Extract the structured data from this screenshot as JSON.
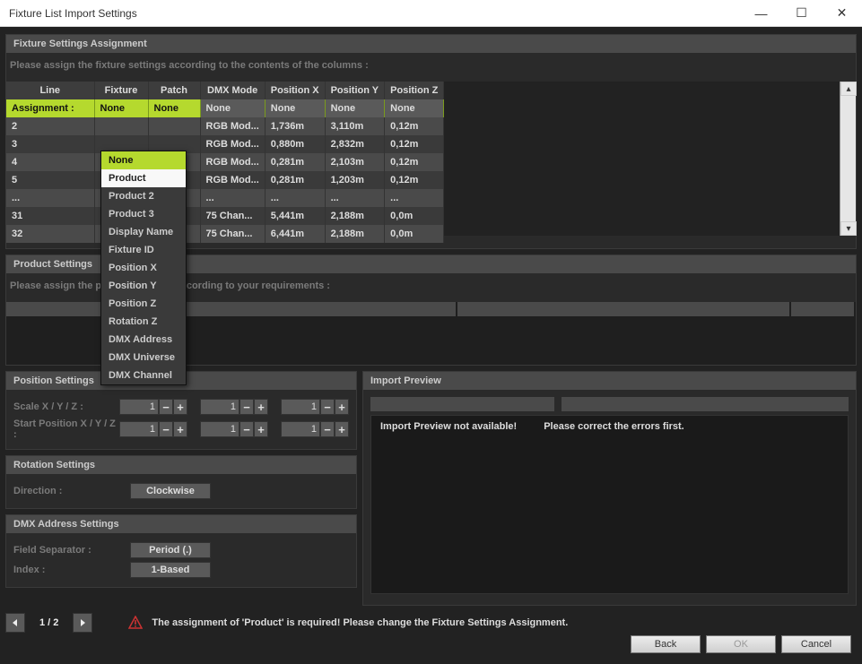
{
  "window": {
    "title": "Fixture List Import Settings",
    "min_icon": "—",
    "max_icon": "☐",
    "close_icon": "✕"
  },
  "fixture_panel": {
    "header": "Fixture Settings Assignment",
    "instruction": "Please assign the fixture settings according to the contents of the columns :",
    "columns": [
      "Line",
      "Fixture",
      "Patch",
      "DMX Mode",
      "Position X",
      "Position Y",
      "Position Z"
    ],
    "assign_label": "Assignment :",
    "assign_values": [
      "None",
      "None",
      "None",
      "None",
      "None",
      "None"
    ],
    "rows": [
      {
        "line": "2",
        "fixture": "",
        "patch": "",
        "dmx": "RGB Mod...",
        "px": "1,736m",
        "py": "3,110m",
        "pz": "0,12m"
      },
      {
        "line": "3",
        "fixture": "",
        "patch": "",
        "dmx": "RGB Mod...",
        "px": "0,880m",
        "py": "2,832m",
        "pz": "0,12m"
      },
      {
        "line": "4",
        "fixture": "",
        "patch": "",
        "dmx": "RGB Mod...",
        "px": "0,281m",
        "py": "2,103m",
        "pz": "0,12m"
      },
      {
        "line": "5",
        "fixture": "",
        "patch": "",
        "dmx": "RGB Mod...",
        "px": "0,281m",
        "py": "1,203m",
        "pz": "0,12m"
      },
      {
        "line": "...",
        "fixture": "",
        "patch": "",
        "dmx": "...",
        "px": "...",
        "py": "...",
        "pz": "..."
      },
      {
        "line": "31",
        "fixture": "",
        "patch": "",
        "dmx": "75 Chan...",
        "px": "5,441m",
        "py": "2,188m",
        "pz": "0,0m"
      },
      {
        "line": "32",
        "fixture": "",
        "patch": "",
        "dmx": "75 Chan...",
        "px": "6,441m",
        "py": "2,188m",
        "pz": "0,0m"
      }
    ]
  },
  "dropdown": {
    "items": [
      "None",
      "Product",
      "Product 2",
      "Product 3",
      "Display Name",
      "Fixture ID",
      "Position X",
      "Position Y",
      "Position Z",
      "Rotation Z",
      "DMX Address",
      "DMX Universe",
      "DMX Channel"
    ],
    "selected": "None",
    "hover": "Product"
  },
  "product_panel": {
    "header": "Product Settings",
    "instruction": "Please assign the product settings according to your requirements :"
  },
  "position_panel": {
    "header": "Position Settings",
    "scale_label": "Scale X / Y / Z :",
    "start_label": "Start Position X / Y / Z :",
    "scale": [
      "1",
      "1",
      "1"
    ],
    "start": [
      "1",
      "1",
      "1"
    ]
  },
  "rotation_panel": {
    "header": "Rotation Settings",
    "direction_label": "Direction :",
    "direction_value": "Clockwise"
  },
  "dmx_panel": {
    "header": "DMX Address Settings",
    "sep_label": "Field Separator :",
    "sep_value": "Period (.)",
    "index_label": "Index :",
    "index_value": "1-Based"
  },
  "preview_panel": {
    "header": "Import Preview",
    "not_available": "Import Preview not available!",
    "correct_errors": "Please correct the errors first."
  },
  "footer": {
    "page": "1 / 2",
    "warning": "The assignment of 'Product' is required! Please change the Fixture Settings Assignment."
  },
  "buttons": {
    "back": "Back",
    "ok": "OK",
    "cancel": "Cancel"
  }
}
